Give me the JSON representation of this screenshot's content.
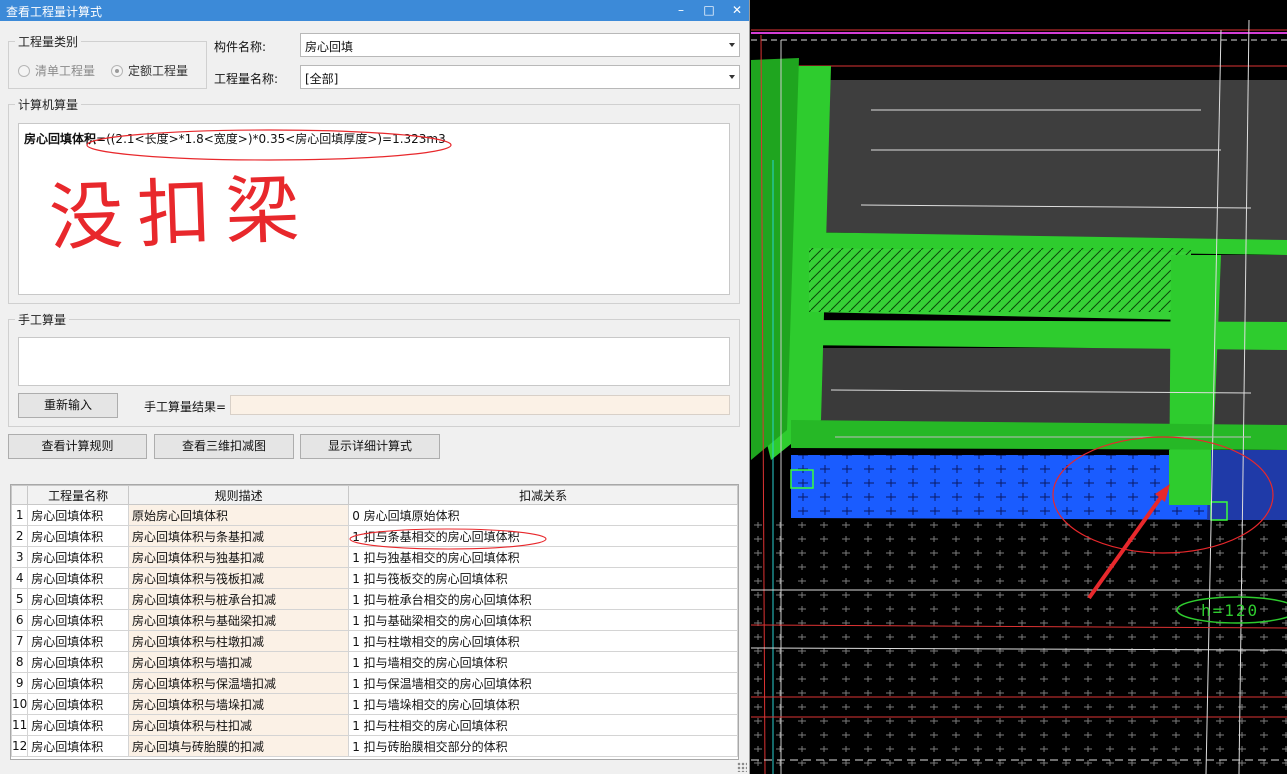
{
  "window": {
    "title": "查看工程量计算式",
    "controls": {
      "minimize": "–",
      "maximize": "□",
      "close": "✕"
    }
  },
  "quantity_type": {
    "label": "工程量类别",
    "options": [
      {
        "label": "清单工程量",
        "selected": false
      },
      {
        "label": "定额工程量",
        "selected": true
      }
    ]
  },
  "component": {
    "label": "构件名称:",
    "value": "房心回填"
  },
  "quantity_name": {
    "label": "工程量名称:",
    "value": "[全部]"
  },
  "computer_calc": {
    "label": "计算机算量",
    "formula_name": "房心回填体积",
    "formula_body": "=((2.1<长度>*1.8<宽度>)*0.35<房心回填厚度>)=1.323m3",
    "annotation": "没扣梁"
  },
  "manual_calc": {
    "label": "手工算量",
    "reenter_button": "重新输入",
    "result_label": "手工算量结果=",
    "result_value": ""
  },
  "buttons": {
    "view_rules": "查看计算规则",
    "view_3d": "查看三维扣减图",
    "show_detail": "显示详细计算式"
  },
  "table": {
    "headers": [
      "工程量名称",
      "规则描述",
      "扣减关系"
    ],
    "rows": [
      {
        "no": "1",
        "name": "房心回填体积",
        "rule": "原始房心回填体积",
        "relation": "0 房心回填原始体积"
      },
      {
        "no": "2",
        "name": "房心回填体积",
        "rule": "房心回填体积与条基扣减",
        "relation": "1  扣与条基相交的房心回填体积"
      },
      {
        "no": "3",
        "name": "房心回填体积",
        "rule": "房心回填体积与独基扣减",
        "relation": "1  扣与独基相交的房心回填体积"
      },
      {
        "no": "4",
        "name": "房心回填体积",
        "rule": "房心回填体积与筏板扣减",
        "relation": "1  扣与筏板交的房心回填体积"
      },
      {
        "no": "5",
        "name": "房心回填体积",
        "rule": "房心回填体积与桩承台扣减",
        "relation": "1  扣与桩承台相交的房心回填体积"
      },
      {
        "no": "6",
        "name": "房心回填体积",
        "rule": "房心回填体积与基础梁扣减",
        "relation": "1  扣与基础梁相交的房心回填体积"
      },
      {
        "no": "7",
        "name": "房心回填体积",
        "rule": "房心回填体积与柱墩扣减",
        "relation": "1  扣与柱墩相交的房心回填体积"
      },
      {
        "no": "8",
        "name": "房心回填体积",
        "rule": "房心回填体积与墙扣减",
        "relation": "1  扣与墙相交的房心回填体积"
      },
      {
        "no": "9",
        "name": "房心回填体积",
        "rule": "房心回填体积与保温墙扣减",
        "relation": "1  扣与保温墙相交的房心回填体积"
      },
      {
        "no": "10",
        "name": "房心回填体积",
        "rule": "房心回填体积与墙垛扣减",
        "relation": "1  扣与墙垛相交的房心回填体积"
      },
      {
        "no": "11",
        "name": "房心回填体积",
        "rule": "房心回填体积与柱扣减",
        "relation": "1  扣与柱相交的房心回填体积"
      },
      {
        "no": "12",
        "name": "房心回填体积",
        "rule": "房心回填与砖胎膜的扣减",
        "relation": "1 扣与砖胎膜相交部分的体积"
      }
    ]
  },
  "cad_view": {
    "label_text": "h=120"
  },
  "colors": {
    "titlebar": "#3c8ad8",
    "cad_green": "#2ecc2e",
    "cad_blue": "#1a5cff",
    "annotation_red": "#e8282c"
  }
}
